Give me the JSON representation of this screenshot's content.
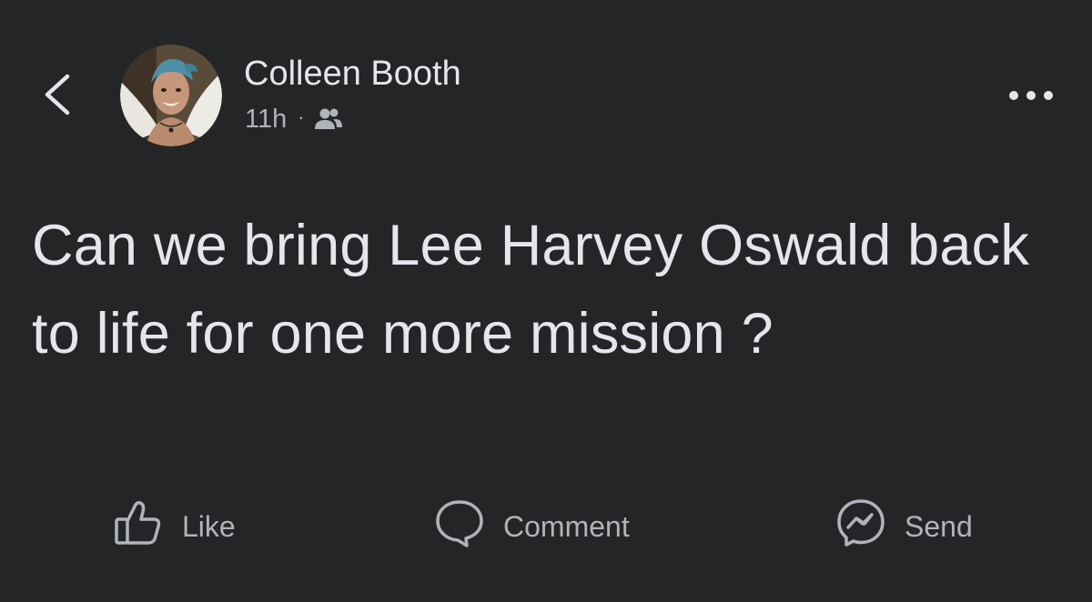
{
  "header": {
    "author_name": "Colleen Booth",
    "timestamp": "11h",
    "separator": "·",
    "audience_icon": "friends-icon",
    "back_icon": "chevron-left-icon",
    "more_icon": "more-horizontal-icon"
  },
  "post": {
    "text": "Can we bring Lee Harvey Oswald back to life for one more mission ?"
  },
  "actions": [
    {
      "label": "Like",
      "icon": "thumbs-up-icon"
    },
    {
      "label": "Comment",
      "icon": "comment-bubble-icon"
    },
    {
      "label": "Send",
      "icon": "messenger-icon"
    }
  ],
  "colors": {
    "background": "#242526",
    "primary_text": "#e4e6eb",
    "secondary_text": "#b0b3b8"
  }
}
